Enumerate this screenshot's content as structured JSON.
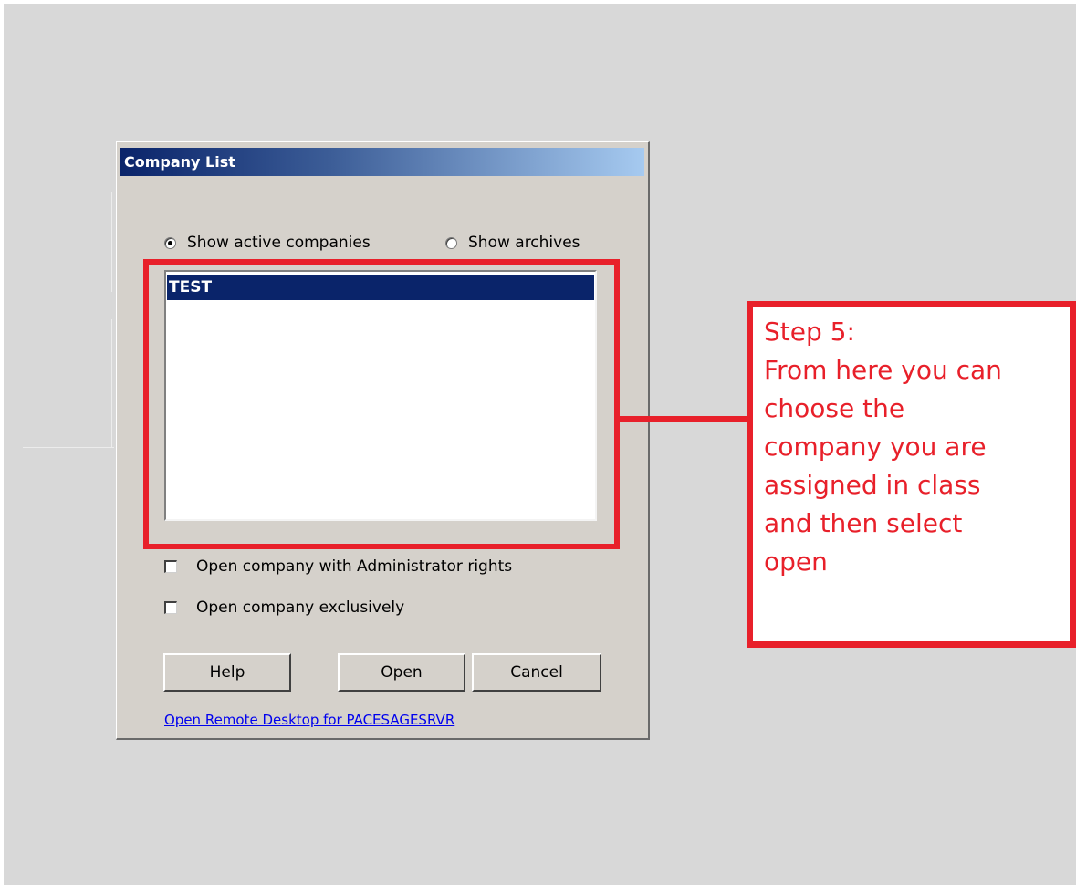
{
  "dialog": {
    "title": "Company List",
    "radio_active_label": "Show active companies",
    "radio_archives_label": "Show archives",
    "radio_selected": "active",
    "companies": [
      "TEST"
    ],
    "selected_company": "TEST",
    "checkbox_admin_label": "Open company with Administrator rights",
    "checkbox_exclusive_label": "Open company exclusively",
    "help_label": "Help",
    "open_label": "Open",
    "cancel_label": "Cancel",
    "remote_link": "Open Remote Desktop for PACESAGESRVR"
  },
  "callout": {
    "lines": [
      "Step 5:",
      "From here you can",
      "choose the",
      "company you are",
      "assigned in class",
      "and then select",
      "open"
    ],
    "color": "#e8202a"
  }
}
